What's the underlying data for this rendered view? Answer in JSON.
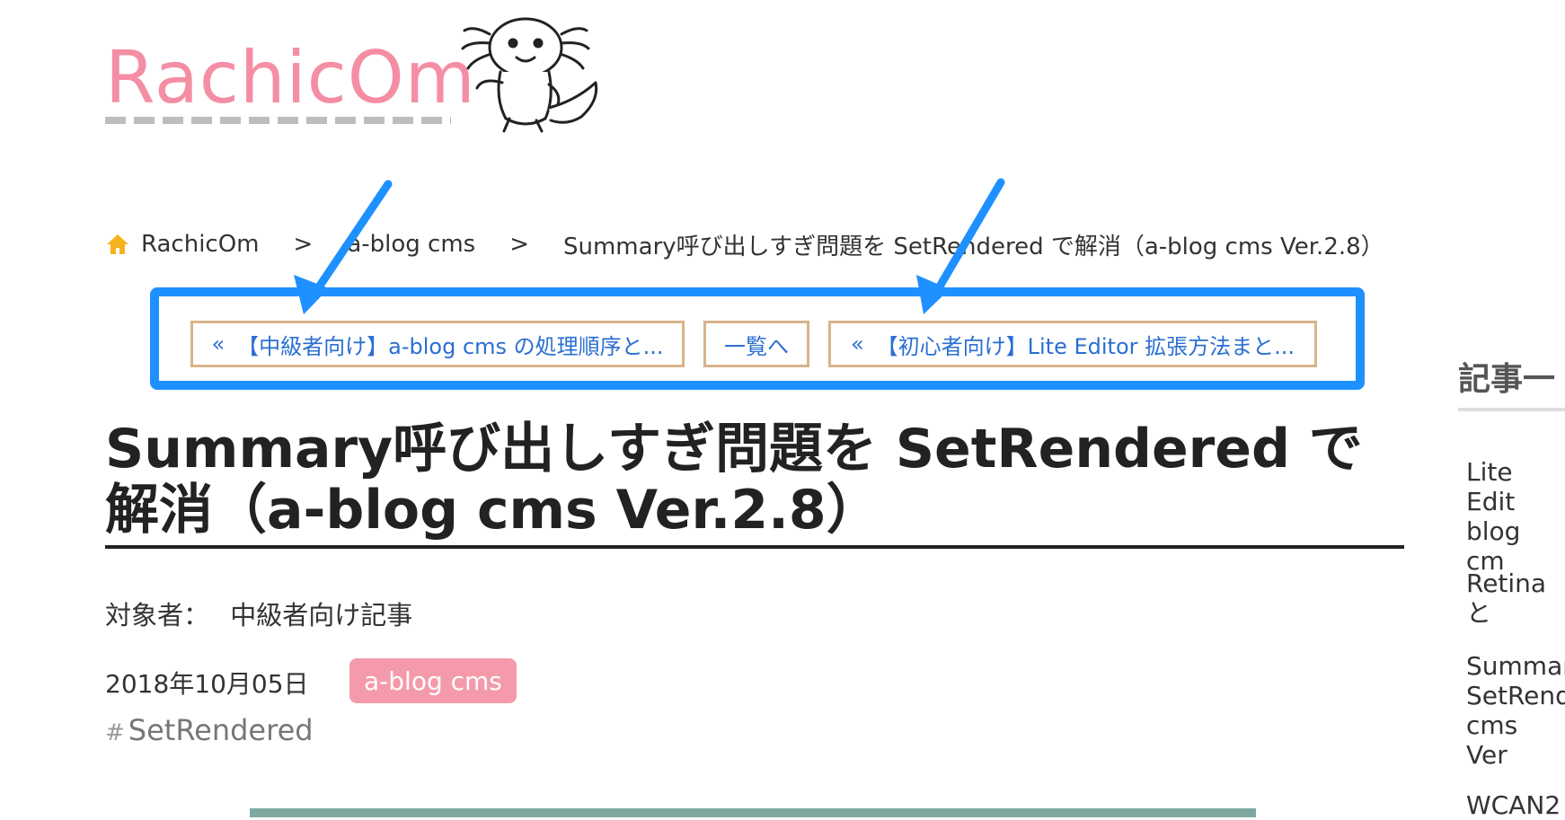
{
  "site": {
    "logo_text": "RachicOm"
  },
  "breadcrumb": {
    "home": "RachicOm",
    "separator": ">",
    "category": "a-blog cms",
    "current": "Summary呼び出しすぎ問題を SetRendered で解消（a-blog cms Ver.2.8）"
  },
  "pager": {
    "prev_arrow": "«",
    "prev_label": "【中級者向け】a-blog cms の処理順序と...",
    "index_label": "一覧へ",
    "next_arrow": "«",
    "next_label": "【初心者向け】Lite Editor 拡張方法まと..."
  },
  "article": {
    "title": "Summary呼び出しすぎ問題を SetRendered で解消（a-blog cms Ver.2.8）",
    "audience_label": "対象者：",
    "audience_value": "中級者向け記事",
    "date": "2018年10月05日",
    "category_badge": "a-blog cms",
    "tag_hash": "#",
    "tag": "SetRendered"
  },
  "sidebar": {
    "heading": "記事一",
    "items": [
      "Lite Edit\nblog cm",
      "Retina と",
      "Summar\nSetRend\ncms Ver",
      "WCAN2"
    ]
  },
  "colors": {
    "logo_pink": "#f48ea4",
    "highlight_blue": "#1e90ff",
    "link_blue": "#2a6fd1",
    "badge_pink": "#f49aaa",
    "pager_border": "#d8b48a"
  }
}
